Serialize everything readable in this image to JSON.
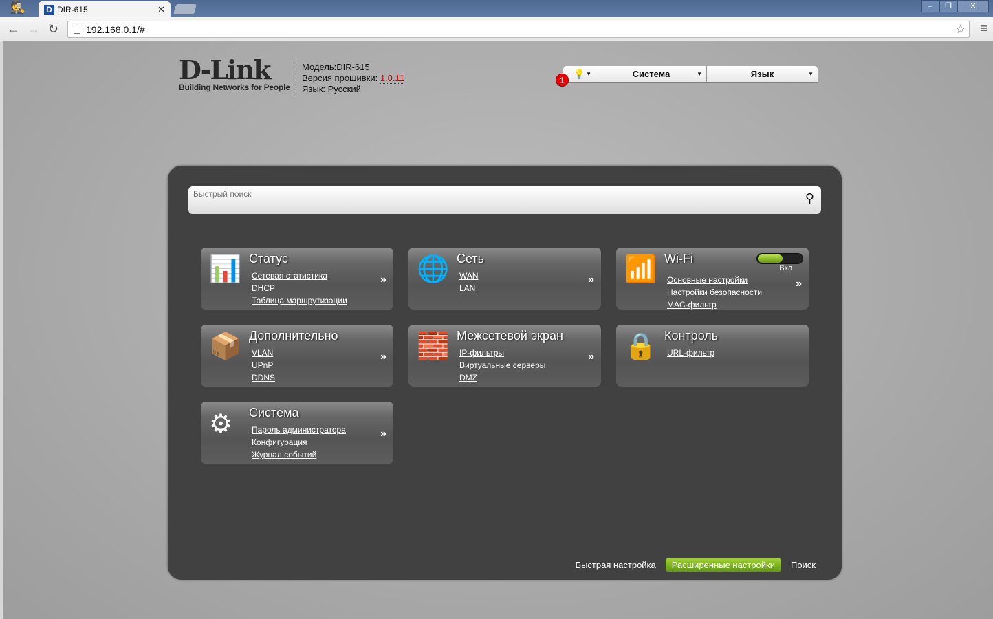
{
  "browser": {
    "tab_title": "DIR-615",
    "url": "192.168.0.1/#"
  },
  "header": {
    "logo": "D-Link",
    "logo_sub": "Building Networks for People",
    "model_label": "Модель:",
    "model": "DIR-615",
    "fw_label": "Версия прошивки:",
    "fw": "1.0.11",
    "lang_label": "Язык:",
    "lang": "Русский"
  },
  "topmenu": {
    "system": "Система",
    "language": "Язык",
    "notifications": "1"
  },
  "search": {
    "placeholder": "Быстрый поиск"
  },
  "cards": [
    {
      "title": "Статус",
      "links": [
        "Сетевая статистика",
        "DHCP",
        "Таблица маршрутизации"
      ]
    },
    {
      "title": "Сеть",
      "links": [
        "WAN",
        "LAN"
      ]
    },
    {
      "title": "Wi-Fi",
      "links": [
        "Основные настройки",
        "Настройки безопасности",
        "MAC-фильтр"
      ],
      "toggle_label": "Вкл",
      "toggle_on": true
    },
    {
      "title": "Дополнительно",
      "links": [
        "VLAN",
        "UPnP",
        "DDNS"
      ]
    },
    {
      "title": "Межсетевой экран",
      "links": [
        "IP-фильтры",
        "Виртуальные серверы",
        "DMZ"
      ]
    },
    {
      "title": "Контроль",
      "links": [
        "URL-фильтр"
      ]
    },
    {
      "title": "Система",
      "links": [
        "Пароль администратора",
        "Конфигурация",
        "Журнал событий"
      ]
    }
  ],
  "more": "»",
  "bottom": {
    "quick": "Быстрая настройка",
    "advanced": "Расширенные настройки",
    "search": "Поиск"
  },
  "colors": {
    "accent": "#7ab51d",
    "panel": "#414141"
  }
}
